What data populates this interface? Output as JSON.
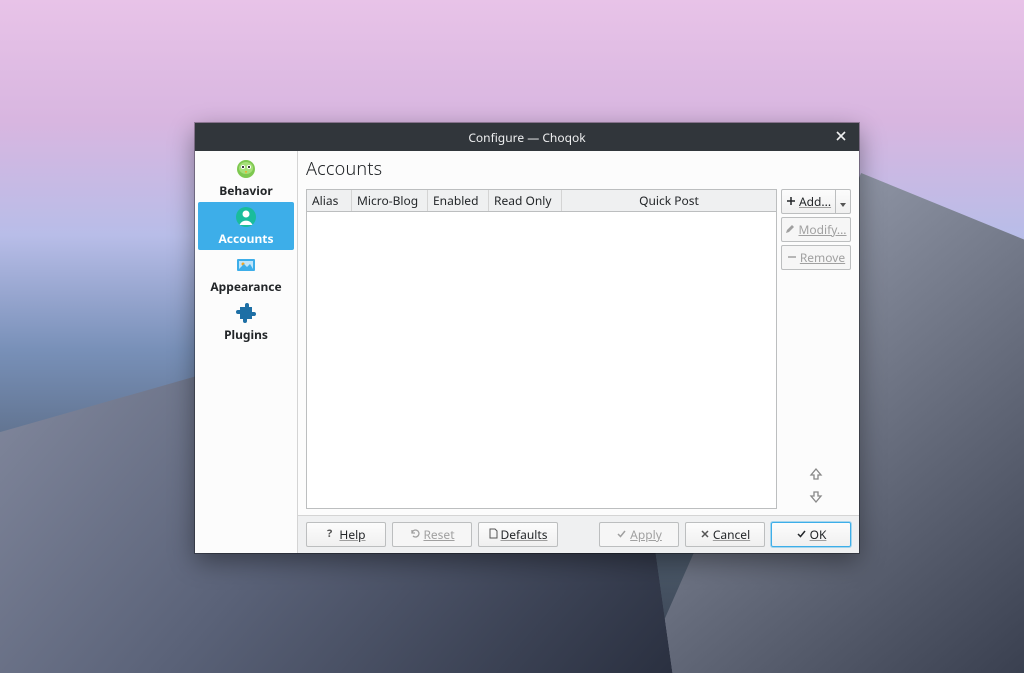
{
  "window": {
    "title": "Configure — Choqok"
  },
  "sidebar": {
    "items": [
      {
        "label": "Behavior",
        "icon": "bird-icon"
      },
      {
        "label": "Accounts",
        "icon": "user-icon",
        "active": true
      },
      {
        "label": "Appearance",
        "icon": "image-icon"
      },
      {
        "label": "Plugins",
        "icon": "puzzle-icon"
      }
    ]
  },
  "page": {
    "title": "Accounts",
    "columns": [
      "Alias",
      "Micro-Blog",
      "Enabled",
      "Read Only",
      "Quick Post"
    ]
  },
  "buttons": {
    "add": "Add...",
    "modify": "Modify...",
    "remove": "Remove"
  },
  "footer": {
    "help": "Help",
    "reset": "Reset",
    "defaults": "Defaults",
    "apply": "Apply",
    "cancel": "Cancel",
    "ok": "OK"
  }
}
